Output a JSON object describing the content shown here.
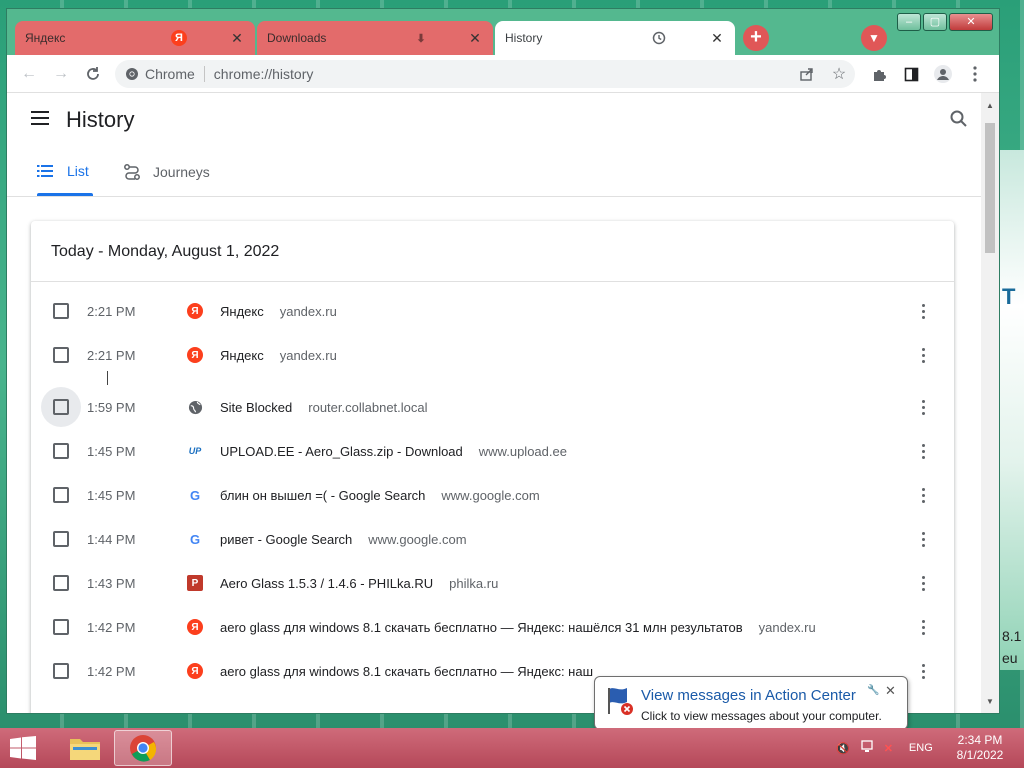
{
  "browser": {
    "tabs": [
      {
        "label": "Яндекс",
        "favicon": "yandex-icon",
        "state": "inactive"
      },
      {
        "label": "Downloads",
        "favicon": "download-icon",
        "state": "inactive"
      },
      {
        "label": "History",
        "favicon": "history-icon",
        "state": "active"
      }
    ],
    "omnibox": {
      "site": "Chrome",
      "url": "chrome://history"
    },
    "colors": {
      "tab_strip": "#e36b6b",
      "accent": "#1a73e8"
    }
  },
  "history": {
    "title": "History",
    "tabs": [
      {
        "label": "List",
        "icon": "list-icon",
        "selected": true
      },
      {
        "label": "Journeys",
        "icon": "journeys-icon",
        "selected": false
      }
    ],
    "date_heading": "Today - Monday, August 1, 2022",
    "entries": [
      {
        "time": "2:21 PM",
        "title": "Яндекс",
        "domain": "yandex.ru",
        "favicon": "yandex-icon"
      },
      {
        "time": "2:21 PM",
        "title": "Яндекс",
        "domain": "yandex.ru",
        "favicon": "yandex-icon"
      },
      {
        "time": "1:59 PM",
        "title": "Site Blocked",
        "domain": "router.collabnet.local",
        "favicon": "globe-icon"
      },
      {
        "time": "1:45 PM",
        "title": "UPLOAD.EE - Aero_Glass.zip - Download",
        "domain": "www.upload.ee",
        "favicon": "upload-ee-icon"
      },
      {
        "time": "1:45 PM",
        "title": "блин он вышел =( - Google Search",
        "domain": "www.google.com",
        "favicon": "google-icon"
      },
      {
        "time": "1:44 PM",
        "title": "ривет - Google Search",
        "domain": "www.google.com",
        "favicon": "google-icon"
      },
      {
        "time": "1:43 PM",
        "title": "Aero Glass 1.5.3 / 1.4.6 - PHILka.RU",
        "domain": "philka.ru",
        "favicon": "philka-icon"
      },
      {
        "time": "1:42 PM",
        "title": "aero glass для windows 8.1 скачать бесплатно — Яндекс: нашёлся 31 млн результатов",
        "domain": "yandex.ru",
        "favicon": "yandex-icon"
      },
      {
        "time": "1:42 PM",
        "title": "aero glass для windows 8.1 скачать бесплатно — Яндекс: наш",
        "domain": "",
        "favicon": "yandex-icon"
      }
    ]
  },
  "notification": {
    "title": "View messages in Action Center",
    "text": "Click to view messages about your computer."
  },
  "taskbar": {
    "language": "ENG",
    "time": "2:34 PM",
    "date": "8/1/2022"
  },
  "desktop": {
    "fragments": [
      "T",
      "8.1",
      "eu"
    ]
  }
}
